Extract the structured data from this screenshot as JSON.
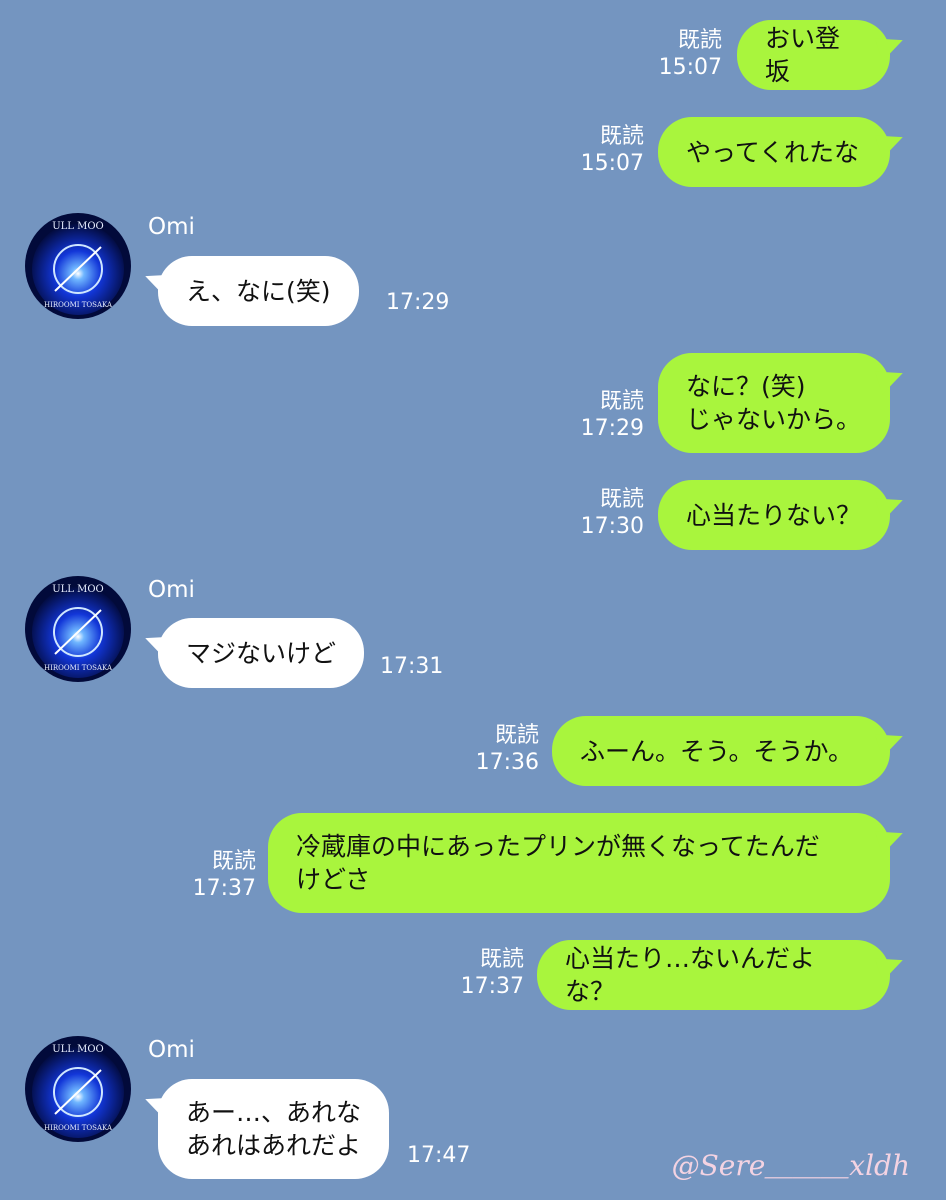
{
  "contact": {
    "name": "Omi"
  },
  "colors": {
    "background": "#7495c0",
    "sent_bubble": "#a9f53d",
    "received_bubble": "#ffffff"
  },
  "read_label": "既読",
  "messages": [
    {
      "dir": "out",
      "text": "おい登坂",
      "time": "15:07",
      "read": "既読"
    },
    {
      "dir": "out",
      "text": "やってくれたな",
      "time": "15:07",
      "read": "既読"
    },
    {
      "dir": "in",
      "sender": "Omi",
      "text": "え、なに(笑)",
      "time": "17:29",
      "avatar_icon": "blue-moon-icon"
    },
    {
      "dir": "out",
      "text": "なに？(笑)\nじゃないから。",
      "time": "17:29",
      "read": "既読"
    },
    {
      "dir": "out",
      "text": "心当たりない？",
      "time": "17:30",
      "read": "既読"
    },
    {
      "dir": "in",
      "sender": "Omi",
      "text": "マジないけど",
      "time": "17:31",
      "avatar_icon": "blue-moon-icon"
    },
    {
      "dir": "out",
      "text": "ふーん。そう。そうか。",
      "time": "17:36",
      "read": "既読"
    },
    {
      "dir": "out",
      "text": "冷蔵庫の中にあったプリンが無くなってたんだ\nけどさ",
      "time": "17:37",
      "read": "既読"
    },
    {
      "dir": "out",
      "text": "心当たり…ないんだよな？",
      "time": "17:37",
      "read": "既読"
    },
    {
      "dir": "in",
      "sender": "Omi",
      "text": "あー…、あれな\nあれはあれだよ",
      "time": "17:47",
      "avatar_icon": "blue-moon-icon"
    }
  ],
  "avatar_text": {
    "top": "ULL MOO",
    "bottom": "HIROOMI TOSAKA"
  },
  "watermark": "@Sere＿＿＿xldh"
}
